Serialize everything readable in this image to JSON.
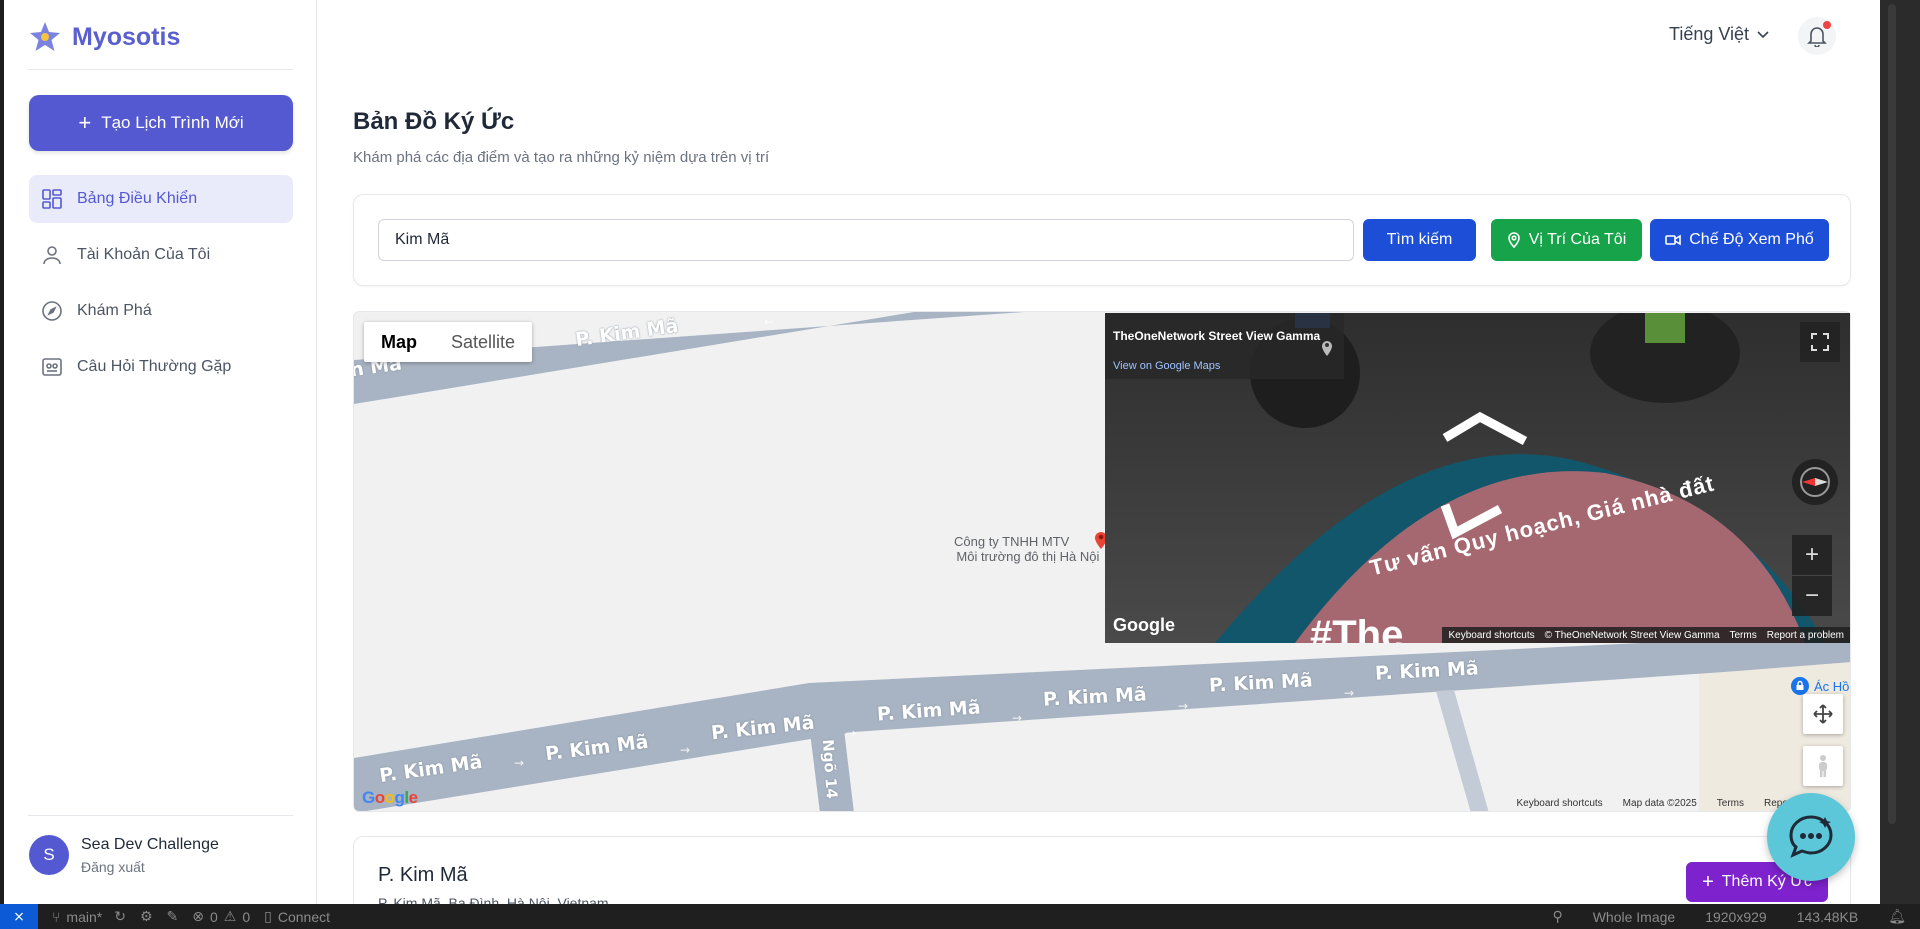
{
  "brand": {
    "name": "Myosotis"
  },
  "sidebar": {
    "new_button": "Tạo Lịch Trình Mới",
    "items": [
      {
        "label": "Bảng Điều Khiển",
        "icon": "dashboard-icon",
        "active": true
      },
      {
        "label": "Tài Khoản Của Tôi",
        "icon": "user-icon",
        "active": false
      },
      {
        "label": "Khám Phá",
        "icon": "compass-icon",
        "active": false
      },
      {
        "label": "Câu Hỏi Thường Gặp",
        "icon": "faq-icon",
        "active": false
      }
    ],
    "user": {
      "initial": "S",
      "name": "Sea Dev Challenge",
      "logout": "Đăng xuất"
    }
  },
  "header": {
    "language": "Tiếng Việt"
  },
  "main": {
    "title": "Bản Đồ Ký Ức",
    "subtitle": "Khám phá các địa điểm và tạo ra những kỷ niệm dựa trên vị trí",
    "search": {
      "value": "Kim Mã"
    },
    "buttons": {
      "search": "Tìm kiếm",
      "my_location": "Vị Trí Của Tôi",
      "street_view": "Chế Độ Xem Phố"
    }
  },
  "map": {
    "toggle": {
      "map": "Map",
      "satellite": "Satellite"
    },
    "road_labels": [
      "P. Kim Mã",
      "n Mã",
      "Ngõ 14"
    ],
    "poi": {
      "line1": "Công ty TNHH MTV",
      "line2": "Môi trường đô thị Hà Nội"
    },
    "area_label": "Ác Hồ",
    "footer": {
      "shortcuts": "Keyboard shortcuts",
      "data": "Map data ©2025",
      "terms": "Terms",
      "report": "Report"
    },
    "google": "Google",
    "street_view": {
      "title": "TheOneNetwork Street View Gamma",
      "link": "View on Google Maps",
      "sign_text": "Tư vấn Quy hoạch, Giá nhà đất",
      "hashtag": "#The",
      "google": "Google",
      "footer": {
        "shortcuts": "Keyboard shortcuts",
        "copyright": "© TheOneNetwork Street View Gamma",
        "terms": "Terms",
        "report": "Report a problem"
      }
    }
  },
  "location_card": {
    "title": "P. Kim Mã",
    "address": "P. Kim Mã, Ba Đình, Hà Nội, Vietnam",
    "add_button": "Thêm Ký Ức"
  },
  "statusbar": {
    "branch": "main*",
    "problems_errors": "0",
    "problems_warnings": "0",
    "connect": "Connect",
    "view_mode": "Whole Image",
    "dimensions": "1920x929",
    "file_size": "143.48KB"
  },
  "colors": {
    "primary": "#5459d1",
    "green": "#16a34a",
    "blue": "#1d4ed8",
    "purple": "#7e22ce",
    "chat": "#5bc7d8"
  }
}
